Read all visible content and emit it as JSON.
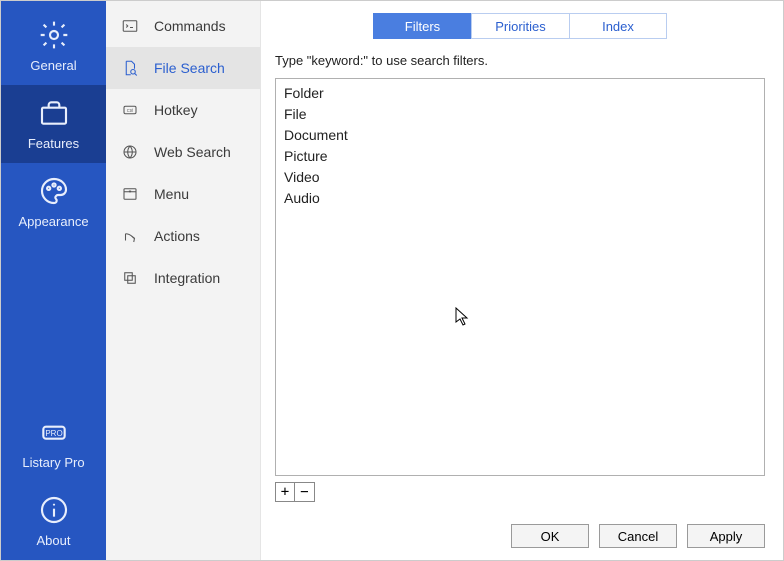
{
  "iconbar": {
    "items": [
      {
        "label": "General"
      },
      {
        "label": "Features"
      },
      {
        "label": "Appearance"
      },
      {
        "label": "Listary Pro"
      },
      {
        "label": "About"
      }
    ]
  },
  "settings": {
    "items": [
      {
        "label": "Commands"
      },
      {
        "label": "File Search"
      },
      {
        "label": "Hotkey"
      },
      {
        "label": "Web Search"
      },
      {
        "label": "Menu"
      },
      {
        "label": "Actions"
      },
      {
        "label": "Integration"
      }
    ]
  },
  "tabs": {
    "items": [
      {
        "label": "Filters"
      },
      {
        "label": "Priorities"
      },
      {
        "label": "Index"
      }
    ]
  },
  "main": {
    "hint": "Type \"keyword:\" to use search filters.",
    "filters": [
      "Folder",
      "File",
      "Document",
      "Picture",
      "Video",
      "Audio"
    ],
    "add_label": "+",
    "remove_label": "−"
  },
  "footer": {
    "ok": "OK",
    "cancel": "Cancel",
    "apply": "Apply"
  }
}
